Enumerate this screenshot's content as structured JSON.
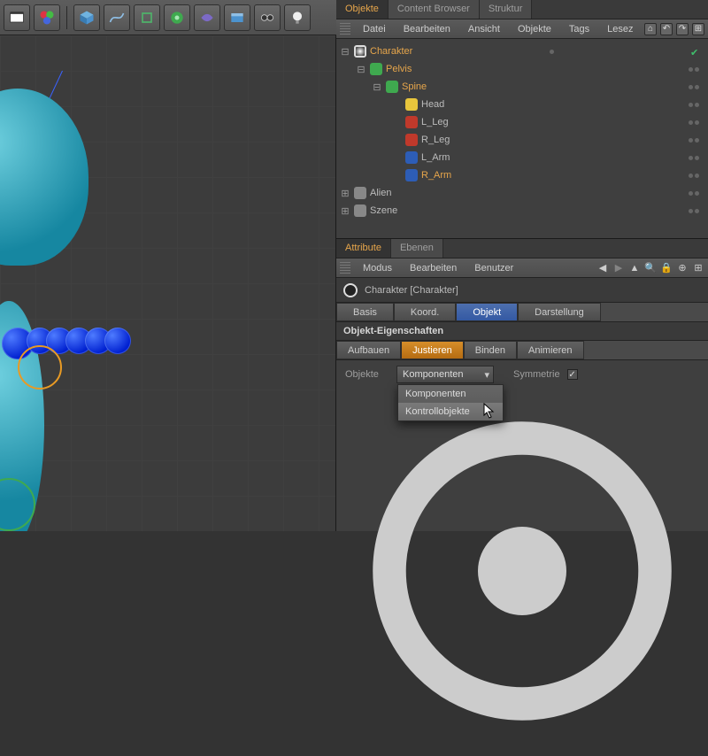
{
  "top_tabs": {
    "objects": "Objekte",
    "content_browser": "Content Browser",
    "structure": "Struktur"
  },
  "top_menu": {
    "file": "Datei",
    "edit": "Bearbeiten",
    "view": "Ansicht",
    "objects": "Objekte",
    "tags": "Tags",
    "bookmarks": "Lesez"
  },
  "tree": {
    "character": "Charakter",
    "pelvis": "Pelvis",
    "spine": "Spine",
    "head": "Head",
    "l_leg": "L_Leg",
    "r_leg": "R_Leg",
    "l_arm": "L_Arm",
    "r_arm": "R_Arm",
    "alien": "Alien",
    "scene": "Szene"
  },
  "attr_tabs": {
    "attributes": "Attribute",
    "layers": "Ebenen"
  },
  "attr_menu": {
    "mode": "Modus",
    "edit": "Bearbeiten",
    "user": "Benutzer"
  },
  "object_header": "Charakter [Charakter]",
  "tabs1": {
    "basis": "Basis",
    "koord": "Koord.",
    "objekt": "Objekt",
    "darstellung": "Darstellung"
  },
  "section_title": "Objekt-Eigenschaften",
  "tabs2": {
    "aufbauen": "Aufbauen",
    "justieren": "Justieren",
    "binden": "Binden",
    "animieren": "Animieren"
  },
  "form": {
    "objects_label": "Objekte",
    "dropdown_value": "Komponenten",
    "dropdown_options": {
      "komponenten": "Komponenten",
      "kontrollobjekte": "Kontrollobjekte"
    },
    "symmetry_label": "Symmetrie"
  },
  "colors": {
    "orange": "#e7a64b",
    "purple": "#7c6ac6",
    "red": "#c0392b",
    "blue_node": "#2d5db6",
    "yellow": "#e8c63c"
  }
}
